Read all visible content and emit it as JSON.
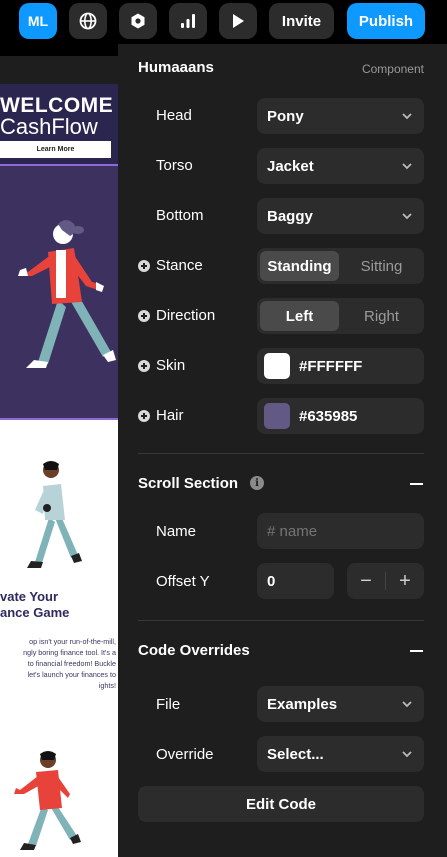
{
  "toolbar": {
    "avatar_initials": "ML",
    "invite_label": "Invite",
    "publish_label": "Publish",
    "icons": [
      "globe-icon",
      "hexagon-icon",
      "bar-chart-icon",
      "play-icon"
    ]
  },
  "canvas": {
    "hero_title": "WELCOME",
    "hero_subtitle": "CashFlow",
    "learn_more": "Learn More",
    "motto_line1": "vate Your",
    "motto_line2": "ance Game",
    "paragraph": [
      "op isn't your run-of-the-mill,",
      "ngly boring finance tool. It's a",
      "to financial freedom! Buckle",
      "let's launch your finances to",
      "ights!"
    ]
  },
  "panel": {
    "component": {
      "title": "Humaaans",
      "subtitle": "Component"
    },
    "head": {
      "label": "Head",
      "value": "Pony"
    },
    "torso": {
      "label": "Torso",
      "value": "Jacket"
    },
    "bottom": {
      "label": "Bottom",
      "value": "Baggy"
    },
    "stance": {
      "label": "Stance",
      "options": [
        "Standing",
        "Sitting"
      ],
      "selected": "Standing"
    },
    "direction": {
      "label": "Direction",
      "options": [
        "Left",
        "Right"
      ],
      "selected": "Left"
    },
    "skin": {
      "label": "Skin",
      "value": "#FFFFFF",
      "color": "#FFFFFF"
    },
    "hair": {
      "label": "Hair",
      "value": "#635985",
      "color": "#635985"
    },
    "scroll_section": {
      "title": "Scroll Section",
      "name_label": "Name",
      "name_placeholder": "# name",
      "offset_label": "Offset Y",
      "offset_value": "0",
      "minus": "−",
      "plus": "+"
    },
    "code_overrides": {
      "title": "Code Overrides",
      "file_label": "File",
      "file_value": "Examples",
      "override_label": "Override",
      "override_value": "Select...",
      "edit_button": "Edit Code"
    }
  },
  "colors": {
    "accent": "#0D99FF",
    "panel_bg": "#1E1E1E",
    "field_bg": "#2C2C2C",
    "hero_bg": "#3D325F"
  }
}
